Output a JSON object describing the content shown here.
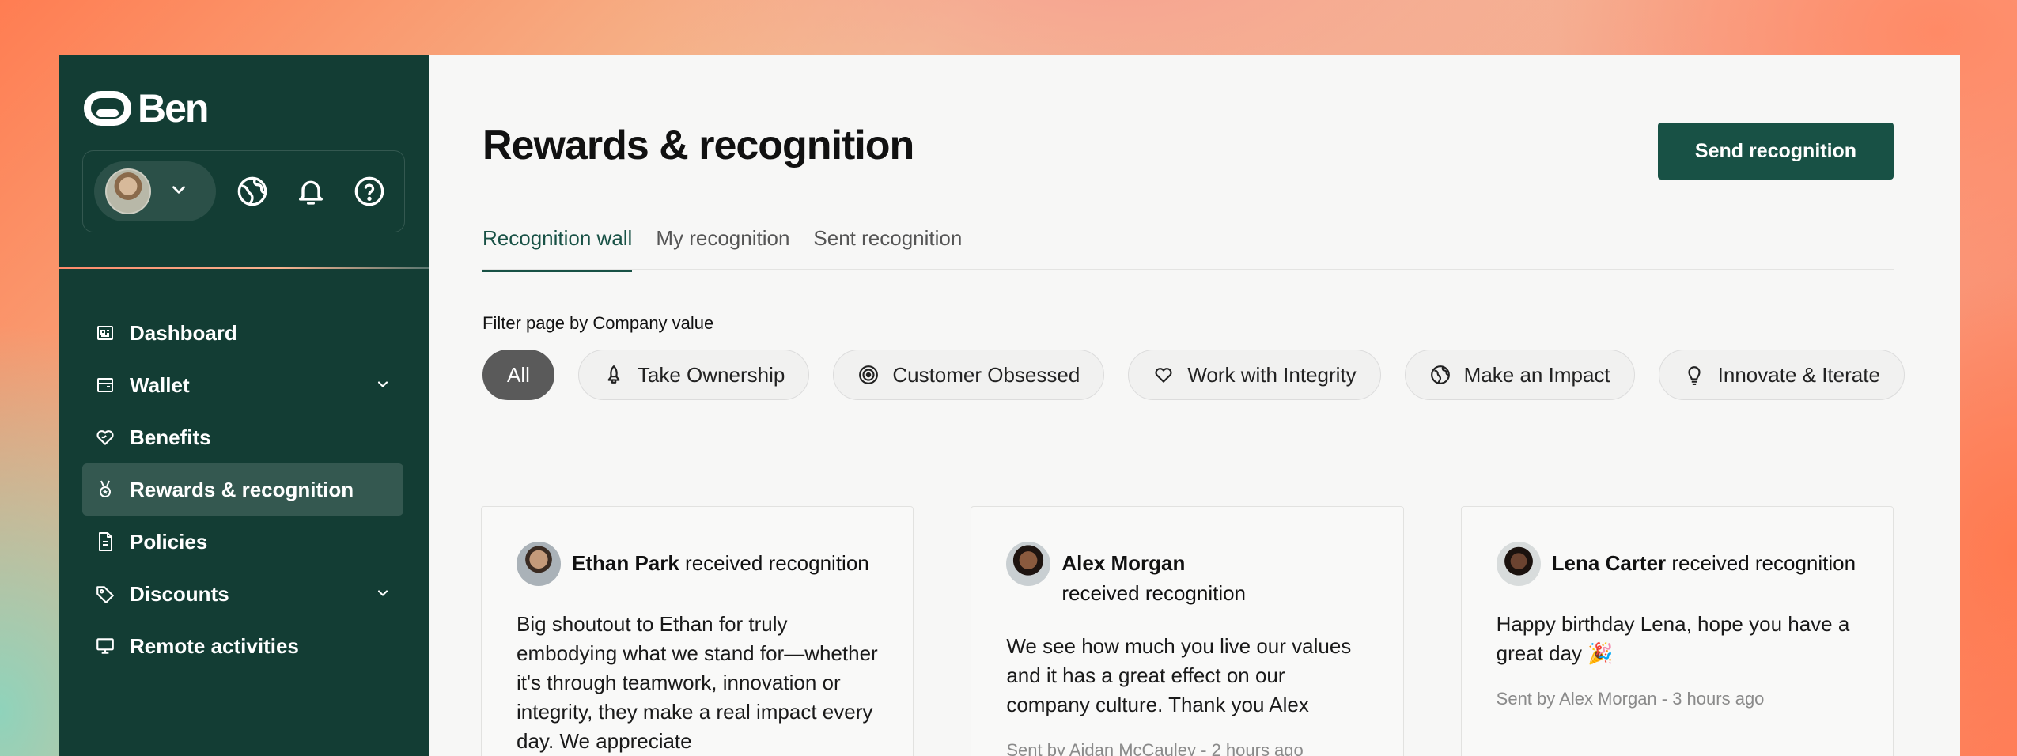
{
  "brand": {
    "name": "Ben"
  },
  "header": {
    "title": "Rewards & recognition",
    "send_button": "Send recognition"
  },
  "sidebar": {
    "top_icons": [
      "globe-icon",
      "bell-icon",
      "help-icon"
    ],
    "items": [
      {
        "label": "Dashboard",
        "icon": "dashboard-icon",
        "expandable": false,
        "active": false
      },
      {
        "label": "Wallet",
        "icon": "wallet-icon",
        "expandable": true,
        "active": false
      },
      {
        "label": "Benefits",
        "icon": "heart-hand-icon",
        "expandable": false,
        "active": false
      },
      {
        "label": "Rewards & recognition",
        "icon": "medal-icon",
        "expandable": false,
        "active": true
      },
      {
        "label": "Policies",
        "icon": "document-icon",
        "expandable": false,
        "active": false
      },
      {
        "label": "Discounts",
        "icon": "tag-icon",
        "expandable": true,
        "active": false
      },
      {
        "label": "Remote activities",
        "icon": "monitor-icon",
        "expandable": false,
        "active": false
      }
    ]
  },
  "tabs": [
    {
      "label": "Recognition wall",
      "active": true
    },
    {
      "label": "My recognition",
      "active": false
    },
    {
      "label": "Sent recognition",
      "active": false
    }
  ],
  "filter": {
    "label": "Filter page by Company value",
    "chips": [
      {
        "label": "All",
        "icon": "",
        "active": true
      },
      {
        "label": "Take Ownership",
        "icon": "rocket-icon",
        "active": false
      },
      {
        "label": "Customer Obsessed",
        "icon": "target-icon",
        "active": false
      },
      {
        "label": "Work with Integrity",
        "icon": "heart-icon",
        "active": false
      },
      {
        "label": "Make an Impact",
        "icon": "globe-icon",
        "active": false
      },
      {
        "label": "Innovate & Iterate",
        "icon": "lightbulb-icon",
        "active": false
      }
    ]
  },
  "cards": [
    {
      "name": "Ethan Park",
      "suffix": " received recognition",
      "message": "Big shoutout to Ethan for truly embodying what we stand for—whether it's through teamwork, innovation or integrity, they make a real impact every day. We appreciate",
      "meta": ""
    },
    {
      "name": "Alex Morgan",
      "suffix": "received recognition",
      "message": "We see how much you live our values and it has a great effect on our company culture. Thank you Alex",
      "meta": "Sent by Aidan McCauley - 2 hours ago"
    },
    {
      "name": "Lena Carter",
      "suffix": " received recognition",
      "message": "Happy birthday Lena, hope you have a great day 🎉",
      "meta": "Sent by Alex Morgan - 3 hours ago"
    }
  ],
  "colors": {
    "sidebar": "#133d34",
    "accent": "#185145",
    "chip_active": "#5a5a5a"
  }
}
